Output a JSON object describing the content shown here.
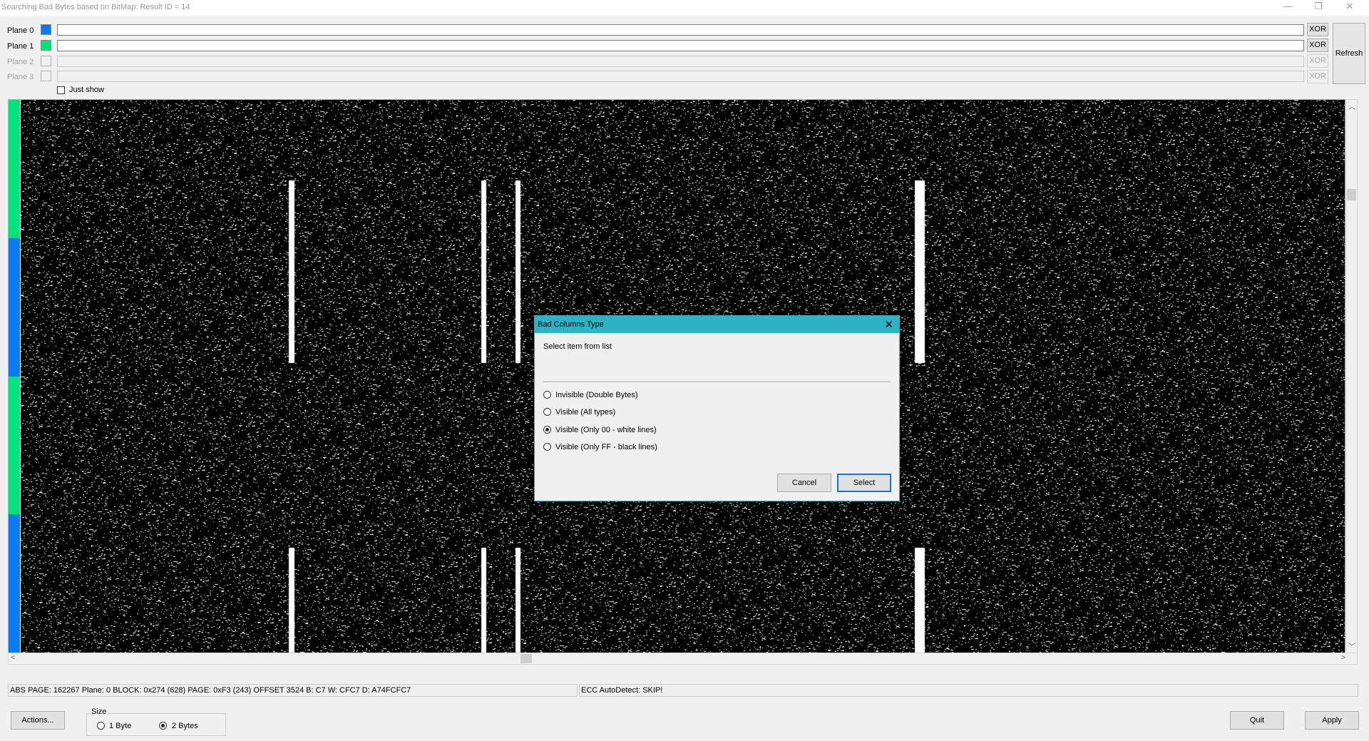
{
  "window": {
    "title": "Searching Bad Bytes based on BitMap: Result ID = 14",
    "minimize_glyph": "—",
    "restore_glyph": "❐",
    "close_glyph": "✕"
  },
  "planes": [
    {
      "label": "Plane 0",
      "color": "#0a7bf0",
      "enabled": true,
      "xor_label": "XOR"
    },
    {
      "label": "Plane 1",
      "color": "#00e37a",
      "enabled": true,
      "xor_label": "XOR"
    },
    {
      "label": "Plane 2",
      "color": "",
      "enabled": false,
      "xor_label": "XOR"
    },
    {
      "label": "Plane 3",
      "color": "",
      "enabled": false,
      "xor_label": "XOR"
    }
  ],
  "refresh_label": "Refresh",
  "just_show": {
    "label": "Just show",
    "checked": false
  },
  "bitmap": {
    "color_strip": [
      "#00e37a",
      "#0a7bf0",
      "#00e37a",
      "#0a7bf0"
    ],
    "pattern": "random black and white noise with white vertical lines (bad columns)"
  },
  "status": {
    "left": "ABS PAGE: 162267   Plane: 0   BLOCK: 0x274 (628)   PAGE: 0xF3 (243)   OFFSET 3524      B: C7 W: CFC7 D: A74FCFC7",
    "right": "ECC AutoDetect: SKIP!"
  },
  "bottom": {
    "actions_label": "Actions...",
    "size_group_label": "Size",
    "size_options": [
      {
        "label": "1 Byte",
        "checked": false
      },
      {
        "label": "2 Bytes",
        "checked": true
      }
    ],
    "quit_label": "Quit",
    "apply_label": "Apply"
  },
  "dialog": {
    "title": "Bad Columns Type",
    "close_glyph": "✕",
    "prompt": "Select item from list",
    "options": [
      {
        "label": "Invisible (Double Bytes)",
        "checked": false
      },
      {
        "label": "Visible (All types)",
        "checked": false
      },
      {
        "label": "Visible (Only 00 - white lines)",
        "checked": true
      },
      {
        "label": "Visible (Only FF - black lines)",
        "checked": false
      }
    ],
    "cancel_label": "Cancel",
    "select_label": "Select"
  }
}
